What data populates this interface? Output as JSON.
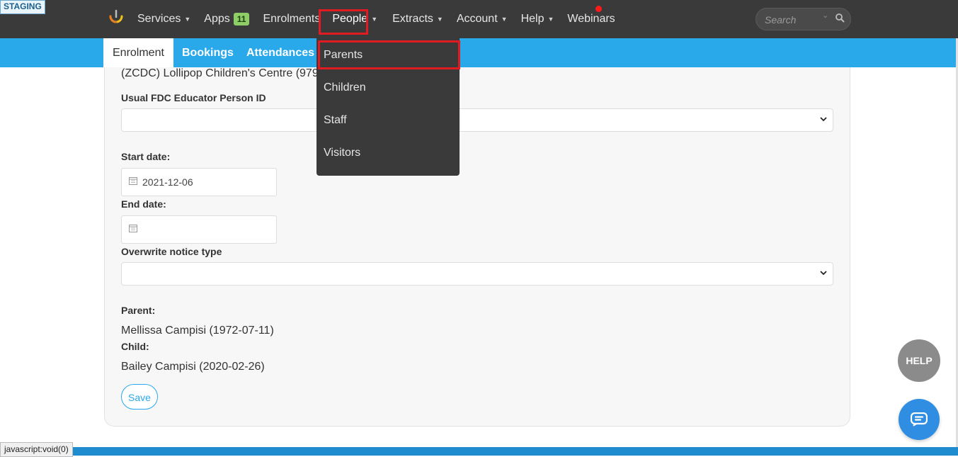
{
  "env_badge": "STAGING",
  "nav": {
    "items": [
      {
        "label": "Services",
        "caret": true
      },
      {
        "label": "Apps",
        "badge": "11"
      },
      {
        "label": "Enrolments"
      },
      {
        "label": "People",
        "caret": true,
        "active": true
      },
      {
        "label": "Extracts",
        "caret": true
      },
      {
        "label": "Account",
        "caret": true
      },
      {
        "label": "Help",
        "caret": true
      },
      {
        "label": "Webinars"
      }
    ],
    "search_placeholder": "Search"
  },
  "subnav": {
    "tabs": [
      "Enrolment",
      "Bookings",
      "Attendances"
    ],
    "active": "Enrolment"
  },
  "people_menu": [
    "Parents",
    "Children",
    "Staff",
    "Visitors"
  ],
  "form": {
    "service": "(ZCDC) Lollipop Children's Centre (979)",
    "fdc_label": "Usual FDC Educator Person ID",
    "fdc_value": "",
    "start_label": "Start date:",
    "start_value": "2021-12-06",
    "end_label": "End date:",
    "end_value": "",
    "notice_label": "Overwrite notice type",
    "notice_value": "",
    "parent_label": "Parent:",
    "parent_value": "Mellissa Campisi (1972-07-11)",
    "child_label": "Child:",
    "child_value": "Bailey Campisi (2020-02-26)",
    "save_label": "Save"
  },
  "widgets": {
    "help_label": "HELP",
    "status_url": "javascript:void(0)"
  },
  "colors": {
    "topbar": "#3a3a3a",
    "subnav": "#29a8ea",
    "highlight": "#e11b22",
    "chat": "#2f8ee2"
  }
}
